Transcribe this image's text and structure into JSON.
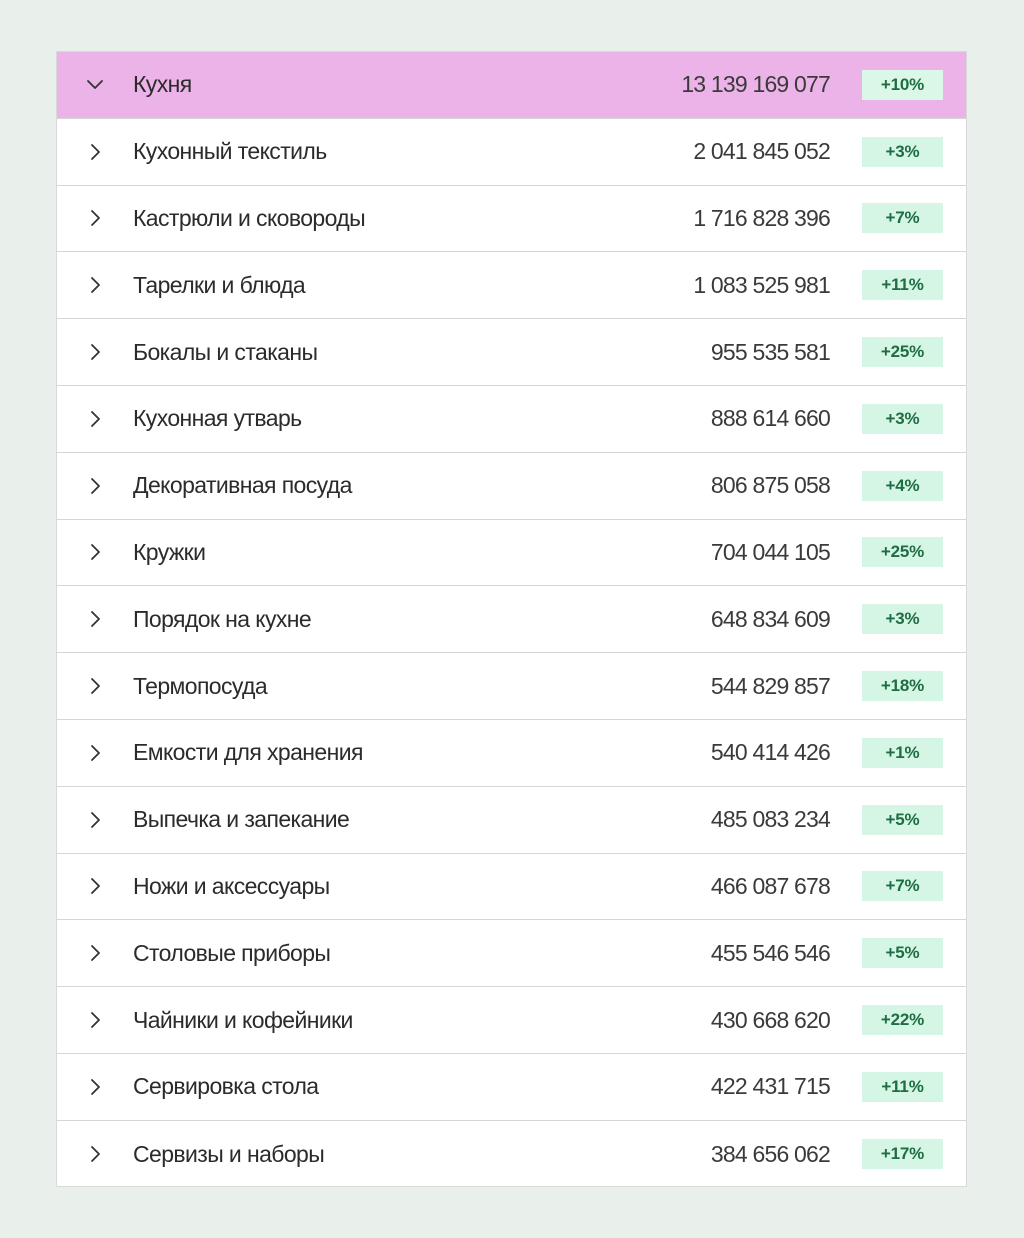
{
  "colors": {
    "background": "#e9efeb",
    "header_row": "#ecb3e8",
    "badge_bg": "#d5f6e5",
    "badge_text": "#1f6d43"
  },
  "header": {
    "label": "Кухня",
    "value": "13 139 169 077",
    "change": "+10%",
    "icon": "chevron-down-icon"
  },
  "rows": [
    {
      "label": "Кухонный текстиль",
      "value": "2 041 845 052",
      "change": "+3%",
      "icon": "chevron-right-icon"
    },
    {
      "label": "Кастрюли и сковороды",
      "value": "1 716 828 396",
      "change": "+7%",
      "icon": "chevron-right-icon"
    },
    {
      "label": "Тарелки и блюда",
      "value": "1 083 525 981",
      "change": "+11%",
      "icon": "chevron-right-icon"
    },
    {
      "label": "Бокалы и стаканы",
      "value": "955 535 581",
      "change": "+25%",
      "icon": "chevron-right-icon"
    },
    {
      "label": "Кухонная утварь",
      "value": "888 614 660",
      "change": "+3%",
      "icon": "chevron-right-icon"
    },
    {
      "label": "Декоративная посуда",
      "value": "806 875 058",
      "change": "+4%",
      "icon": "chevron-right-icon"
    },
    {
      "label": "Кружки",
      "value": "704 044 105",
      "change": "+25%",
      "icon": "chevron-right-icon"
    },
    {
      "label": "Порядок на кухне",
      "value": "648 834 609",
      "change": "+3%",
      "icon": "chevron-right-icon"
    },
    {
      "label": "Термопосуда",
      "value": "544 829 857",
      "change": "+18%",
      "icon": "chevron-right-icon"
    },
    {
      "label": "Емкости для хранения",
      "value": "540  414 426",
      "change": "+1%",
      "icon": "chevron-right-icon"
    },
    {
      "label": "Выпечка и запекание",
      "value": "485 083 234",
      "change": "+5%",
      "icon": "chevron-right-icon"
    },
    {
      "label": "Ножи и аксессуары",
      "value": "466 087 678",
      "change": "+7%",
      "icon": "chevron-right-icon"
    },
    {
      "label": "Столовые приборы",
      "value": "455 546 546",
      "change": "+5%",
      "icon": "chevron-right-icon"
    },
    {
      "label": "Чайники и кофейники",
      "value": "430 668 620",
      "change": "+22%",
      "icon": "chevron-right-icon"
    },
    {
      "label": "Сервировка стола",
      "value": "422 431 715",
      "change": "+11%",
      "icon": "chevron-right-icon"
    },
    {
      "label": "Сервизы и наборы",
      "value": "384 656 062",
      "change": "+17%",
      "icon": "chevron-right-icon"
    }
  ]
}
